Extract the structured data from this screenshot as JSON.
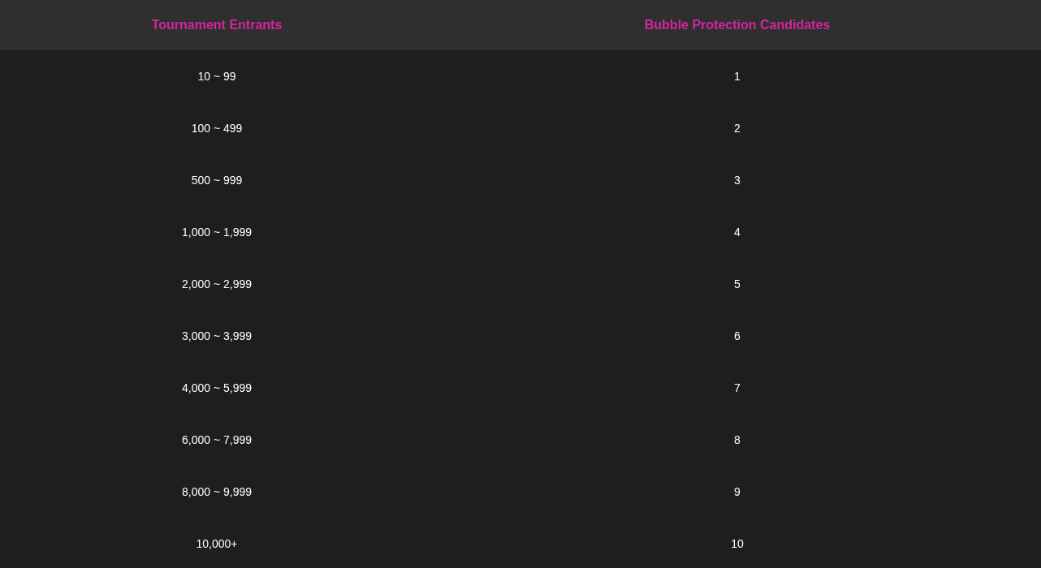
{
  "table": {
    "columns": [
      "Tournament Entrants",
      "Bubble Protection Candidates"
    ],
    "rows": [
      [
        "10 ~ 99",
        "1"
      ],
      [
        "100 ~ 499",
        "2"
      ],
      [
        "500 ~ 999",
        "3"
      ],
      [
        "1,000 ~ 1,999",
        "4"
      ],
      [
        "2,000 ~ 2,999",
        "5"
      ],
      [
        "3,000 ~ 3,999",
        "6"
      ],
      [
        "4,000 ~ 5,999",
        "7"
      ],
      [
        "6,000 ~ 7,999",
        "8"
      ],
      [
        "8,000 ~ 9,999",
        "9"
      ],
      [
        "10,000+",
        "10"
      ]
    ]
  }
}
